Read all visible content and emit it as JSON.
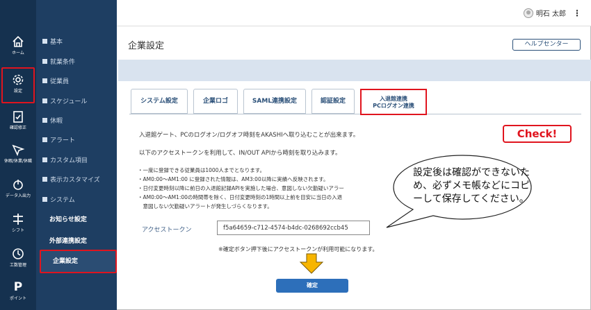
{
  "topbar": {
    "user_name": "明石 太郎",
    "menu_glyph": "⋮"
  },
  "rail": [
    {
      "name": "home",
      "label": "ホーム"
    },
    {
      "name": "settings",
      "label": "設定"
    },
    {
      "name": "correction",
      "label": "確認修正"
    },
    {
      "name": "leave",
      "label": "休暇/休業/休職"
    },
    {
      "name": "export",
      "label": "データ入出力"
    },
    {
      "name": "shift",
      "label": "シフト"
    },
    {
      "name": "worktime",
      "label": "工数管理"
    },
    {
      "name": "point",
      "label": "ポイント"
    }
  ],
  "rail_point_glyph": "P",
  "subnav": {
    "items": [
      "基本",
      "就業条件",
      "従業員",
      "スケジュール",
      "休暇",
      "アラート",
      "カスタム項目",
      "表示カスタマイズ",
      "システム"
    ],
    "system_children": [
      "お知らせ設定",
      "外部連携設定",
      "企業設定"
    ]
  },
  "page": {
    "title": "企業設定",
    "help_label": "ヘルプセンター"
  },
  "tabs": [
    "システム設定",
    "企業ロゴ",
    "SAML連携設定",
    "認証設定"
  ],
  "active_tab": {
    "line1": "入退館連携",
    "line2": "PCログオン連携"
  },
  "content": {
    "p1": "入退館ゲート、PCのログオン/ログオフ時刻をAKASHIへ取り込むことが出来ます。",
    "p2": "以下のアクセストークンを利用して、IN/OUT APIから時刻を取り込みます。",
    "bullets": [
      "・一度に登録できる従業員は1000人までとなります。",
      "・AM0:00～AM1:00 に登録された情報は、AM3:00以降に実績へ反映されます。",
      "・日付変更時刻以降に前日の入退館記録APIを実施した場合、意図しない欠勤疑いアラー",
      "・AM0:00～AM1:00の時間帯を除く、日付変更時刻の1時間以上前を目安に当日の入退",
      "　意図しない欠勤疑いアラートが発生しづらくなります。"
    ],
    "token_label": "アクセストークン",
    "token_value": "f5a64659-c712-4574-b4dc-0268692ccb45",
    "note": "※確定ボタン押下後にアクセストークンが利用可能になります。",
    "confirm_label": "確定"
  },
  "annotation": {
    "check_label": "Check!",
    "bubble_text": "設定後は確認ができないため、必ずメモ帳などにコピーして保存してください。"
  },
  "colors": {
    "rail_bg": "#15314f",
    "subnav_bg": "#1e3e62",
    "highlight": "#e0141e",
    "primary": "#2d6fba",
    "band": "#d9e3ef",
    "arrow": "#f7b500"
  }
}
